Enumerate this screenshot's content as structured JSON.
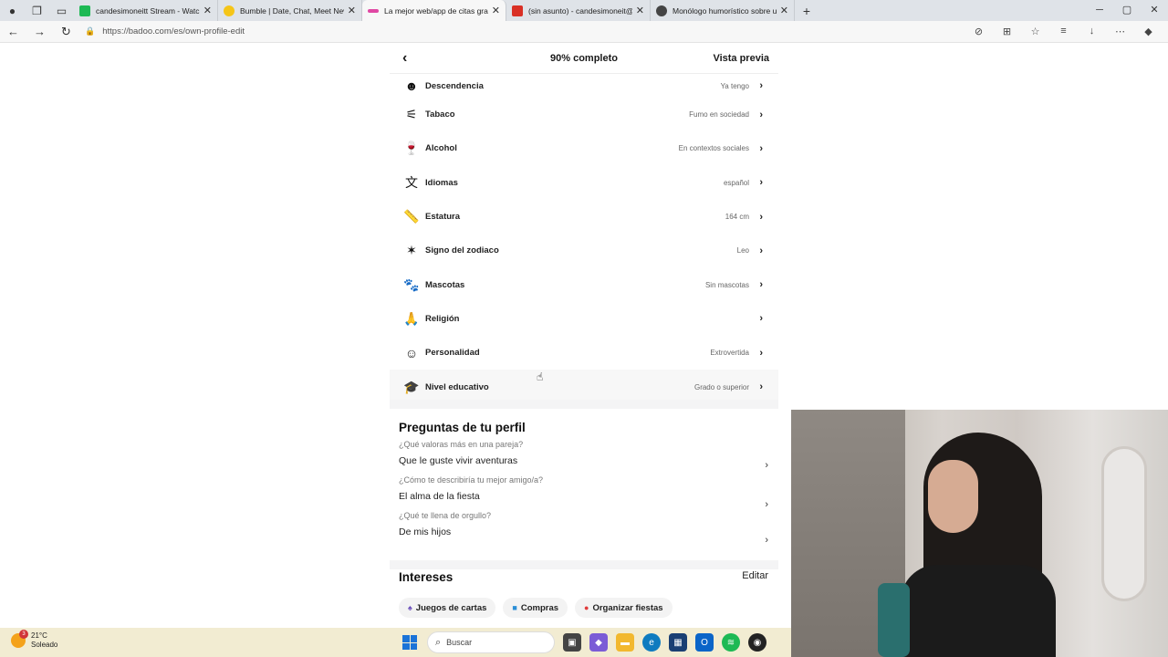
{
  "browser": {
    "tabs": [
      {
        "title": "candesimoneitt Stream - Watch L",
        "favicon_color": "#1db954"
      },
      {
        "title": "Bumble | Date, Chat, Meet New P",
        "favicon_color": "#f5c518"
      },
      {
        "title": "La mejor web/app de citas gratis",
        "favicon_color": "#e048a3"
      },
      {
        "title": "(sin asunto) - candesimoneit@gm",
        "favicon_color": "#d93025"
      },
      {
        "title": "Monólogo humorístico sobre un",
        "favicon_color": "#444444"
      }
    ],
    "url": "https://badoo.com/es/own-profile-edit"
  },
  "header": {
    "back_icon": "chevron-left-icon",
    "title": "90% completo",
    "preview": "Vista previa"
  },
  "profile_rows": [
    {
      "label": "Descendencia",
      "value": "Ya tengo",
      "icon": "baby-icon"
    },
    {
      "label": "Tabaco",
      "value": "Fumo en sociedad",
      "icon": "smoke-icon"
    },
    {
      "label": "Alcohol",
      "value": "En contextos sociales",
      "icon": "wine-glass-icon"
    },
    {
      "label": "Idiomas",
      "value": "español",
      "icon": "translate-icon"
    },
    {
      "label": "Estatura",
      "value": "164 cm",
      "icon": "ruler-icon"
    },
    {
      "label": "Signo del zodiaco",
      "value": "Leo",
      "icon": "constellation-icon"
    },
    {
      "label": "Mascotas",
      "value": "Sin mascotas",
      "icon": "paw-icon"
    },
    {
      "label": "Religión",
      "value": "",
      "icon": "praying-hands-icon"
    },
    {
      "label": "Personalidad",
      "value": "Extrovertida",
      "icon": "head-profile-icon"
    },
    {
      "label": "Nivel educativo",
      "value": "Grado o superior",
      "icon": "graduation-cap-icon"
    }
  ],
  "questions": {
    "title": "Preguntas de tu perfil",
    "items": [
      {
        "question": "¿Qué valoras más en una pareja?",
        "answer": "Que le guste vivir aventuras"
      },
      {
        "question": "¿Cómo te describiría tu mejor amigo/a?",
        "answer": "El alma de la fiesta"
      },
      {
        "question": "¿Qué te llena de orgullo?",
        "answer": "De mis hijos"
      }
    ]
  },
  "interests": {
    "title": "Intereses",
    "edit": "Editar",
    "chips": [
      {
        "label": "Juegos de cartas",
        "icon": "spade-icon"
      },
      {
        "label": "Compras",
        "icon": "shopping-bag-icon"
      },
      {
        "label": "Organizar fiestas",
        "icon": "balloon-icon"
      }
    ]
  },
  "taskbar": {
    "weather_temp": "21°C",
    "weather_desc": "Soleado",
    "weather_badge": "3",
    "search_placeholder": "Buscar"
  }
}
